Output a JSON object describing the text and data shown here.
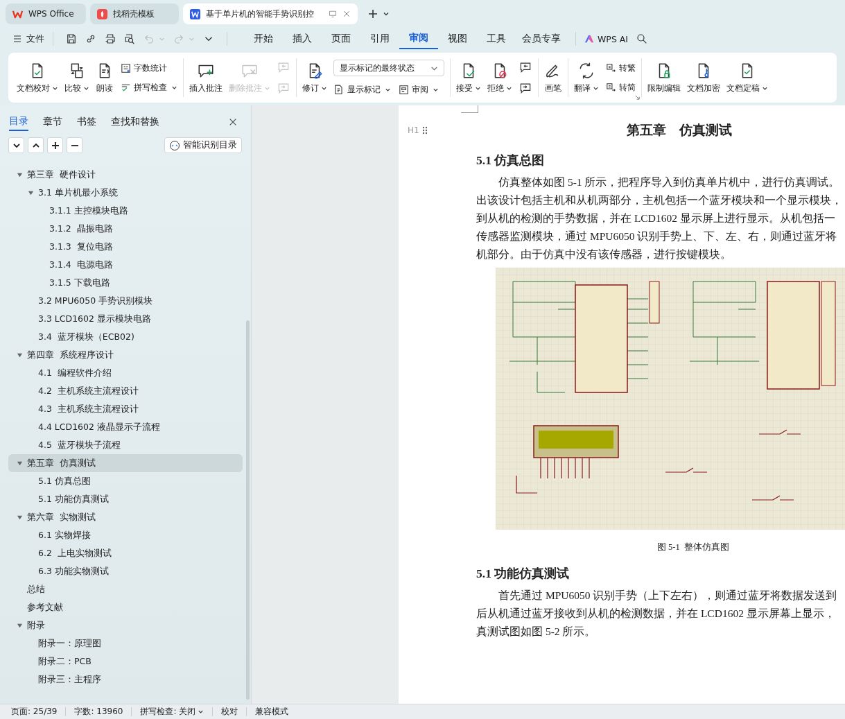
{
  "browser_tabs": [
    {
      "label": "WPS Office",
      "selected": false
    },
    {
      "label": "找稻壳模板",
      "selected": false
    },
    {
      "label": "基于单片机的智能手势识别控",
      "selected": true
    }
  ],
  "menu": {
    "file": "文件",
    "quick_access": [
      {
        "disabled": false
      },
      {
        "disabled": false
      },
      {
        "disabled": false
      },
      {
        "disabled": false
      },
      {
        "disabled": true
      },
      {
        "disabled": true
      }
    ],
    "tabs": [
      {
        "label": "开始",
        "selected": false
      },
      {
        "label": "插入",
        "selected": false
      },
      {
        "label": "页面",
        "selected": false
      },
      {
        "label": "引用",
        "selected": false
      },
      {
        "label": "审阅",
        "selected": true
      },
      {
        "label": "视图",
        "selected": false
      },
      {
        "label": "工具",
        "selected": false
      },
      {
        "label": "会员专享",
        "selected": false
      }
    ],
    "ai": "WPS AI"
  },
  "ribbon": {
    "groups": [
      {
        "items": [
          {
            "kind": "large",
            "label": "文档校对",
            "dropdown": true,
            "disabled": false
          },
          {
            "kind": "large",
            "label": "比较",
            "dropdown": true,
            "disabled": false
          },
          {
            "kind": "large",
            "label": "朗读",
            "dropdown": false,
            "disabled": false
          },
          {
            "kind": "pair",
            "rows": [
              {
                "label": "字数统计",
                "dropdown": false
              },
              {
                "label": "拼写检查",
                "dropdown": true
              }
            ]
          }
        ]
      },
      {
        "items": [
          {
            "kind": "large",
            "label": "插入批注",
            "dropdown": false,
            "disabled": false
          },
          {
            "kind": "large",
            "label": "删除批注",
            "dropdown": true,
            "disabled": true
          },
          {
            "kind": "iconpair",
            "disabled": true
          }
        ]
      },
      {
        "items": [
          {
            "kind": "large",
            "label": "修订",
            "dropdown": true,
            "disabled": false
          },
          {
            "kind": "markup",
            "select": "显示标记的最终状态",
            "rows": [
              {
                "label": "显示标记",
                "dropdown": true
              },
              {
                "label": "审阅",
                "dropdown": true
              }
            ]
          }
        ]
      },
      {
        "items": [
          {
            "kind": "large",
            "label": "接受",
            "dropdown": true,
            "disabled": false
          },
          {
            "kind": "large",
            "label": "拒绝",
            "dropdown": true,
            "disabled": false
          },
          {
            "kind": "iconpair",
            "disabled": false
          }
        ]
      },
      {
        "items": [
          {
            "kind": "large",
            "label": "画笔",
            "dropdown": false,
            "disabled": false
          }
        ]
      },
      {
        "items": [
          {
            "kind": "large",
            "label": "翻译",
            "dropdown": true,
            "disabled": false
          },
          {
            "kind": "pair",
            "rows": [
              {
                "label": "转繁",
                "dropdown": false
              },
              {
                "label": "转简",
                "dropdown": false
              }
            ]
          }
        ]
      },
      {
        "items": [
          {
            "kind": "large",
            "label": "限制编辑",
            "dropdown": false,
            "disabled": false
          },
          {
            "kind": "large",
            "label": "文档加密",
            "dropdown": false,
            "disabled": false
          },
          {
            "kind": "large",
            "label": "文档定稿",
            "dropdown": true,
            "disabled": false
          }
        ]
      }
    ]
  },
  "sidebar": {
    "tabs": [
      {
        "label": "目录",
        "selected": true
      },
      {
        "label": "章节",
        "selected": false
      },
      {
        "label": "书签",
        "selected": false
      },
      {
        "label": "查找和替换",
        "selected": false
      }
    ],
    "smart_button": "智能识别目录",
    "toc": [
      {
        "label": "第三章  硬件设计",
        "selected": false,
        "expanded": true,
        "children": [
          {
            "label": "3.1 单片机最小系统",
            "selected": false,
            "expanded": true,
            "children": [
              {
                "label": "3.1.1 主控模块电路",
                "selected": false
              },
              {
                "label": "3.1.2  晶振电路",
                "selected": false
              },
              {
                "label": "3.1.3  复位电路",
                "selected": false
              },
              {
                "label": "3.1.4  电源电路",
                "selected": false
              },
              {
                "label": "3.1.5 下载电路",
                "selected": false
              }
            ]
          },
          {
            "label": "3.2 MPU6050 手势识别模块",
            "selected": false
          },
          {
            "label": "3.3 LCD1602 显示模块电路",
            "selected": false
          },
          {
            "label": "3.4  蓝牙模块（ECB02)",
            "selected": false
          }
        ]
      },
      {
        "label": "第四章  系统程序设计",
        "selected": false,
        "expanded": true,
        "children": [
          {
            "label": "4.1  编程软件介绍",
            "selected": false
          },
          {
            "label": "4.2  主机系统主流程设计",
            "selected": false
          },
          {
            "label": "4.3  主机系统主流程设计",
            "selected": false
          },
          {
            "label": "4.4 LCD1602 液晶显示子流程",
            "selected": false
          },
          {
            "label": "4.5  蓝牙模块子流程",
            "selected": false
          }
        ]
      },
      {
        "label": "第五章  仿真测试",
        "selected": true,
        "expanded": true,
        "children": [
          {
            "label": "5.1 仿真总图",
            "selected": false
          },
          {
            "label": "5.1 功能仿真测试",
            "selected": false
          }
        ]
      },
      {
        "label": "第六章  实物测试",
        "selected": false,
        "expanded": true,
        "children": [
          {
            "label": "6.1 实物焊接",
            "selected": false
          },
          {
            "label": "6.2  上电实物测试",
            "selected": false
          },
          {
            "label": "6.3 功能实物测试",
            "selected": false
          }
        ]
      },
      {
        "label": "总结",
        "selected": false
      },
      {
        "label": "参考文献",
        "selected": false
      },
      {
        "label": "附录",
        "selected": false,
        "expanded": true,
        "children": [
          {
            "label": "附录一：原理图",
            "selected": false
          },
          {
            "label": "附录二：PCB",
            "selected": false
          },
          {
            "label": "附录三：主程序",
            "selected": false
          }
        ]
      }
    ]
  },
  "document": {
    "heading_marker": "H1",
    "chapter_title": "第五章　仿真测试",
    "blocks": [
      {
        "kind": "heading",
        "text": "5.1 仿真总图"
      },
      {
        "kind": "paragraph",
        "lines": [
          "仿真整体如图 5-1 所示，把程序导入到仿真单片机中，进行仿真调试。",
          "出该设计包括主机和从机两部分，主机包括一个蓝牙模块和一个显示模块，",
          "到从机的检测的手势数据，并在 LCD1602 显示屏上进行显示。从机包括一",
          "传感器监测模块，通过 MPU6050 识别手势上、下、左、右，则通过蓝牙将",
          "机部分。由于仿真中没有该传感器，进行按键模块。"
        ]
      },
      {
        "kind": "figure",
        "caption": "图 5-1  整体仿真图"
      },
      {
        "kind": "heading",
        "text": "5.1 功能仿真测试"
      },
      {
        "kind": "paragraph",
        "lines": [
          "首先通过 MPU6050 识别手势（上下左右），则通过蓝牙将数据发送到",
          "后从机通过蓝牙接收到从机的检测数据，并在 LCD1602 显示屏幕上显示，",
          "真测试图如图 5-2 所示。"
        ]
      }
    ]
  },
  "status_bar": [
    {
      "label": "页面: 25/39",
      "dropdown": false
    },
    {
      "label": "字数: 13960",
      "dropdown": false
    },
    {
      "label": "拼写检查: 关闭",
      "dropdown": true
    },
    {
      "label": "校对",
      "dropdown": false
    },
    {
      "label": "兼容模式",
      "dropdown": false
    }
  ]
}
